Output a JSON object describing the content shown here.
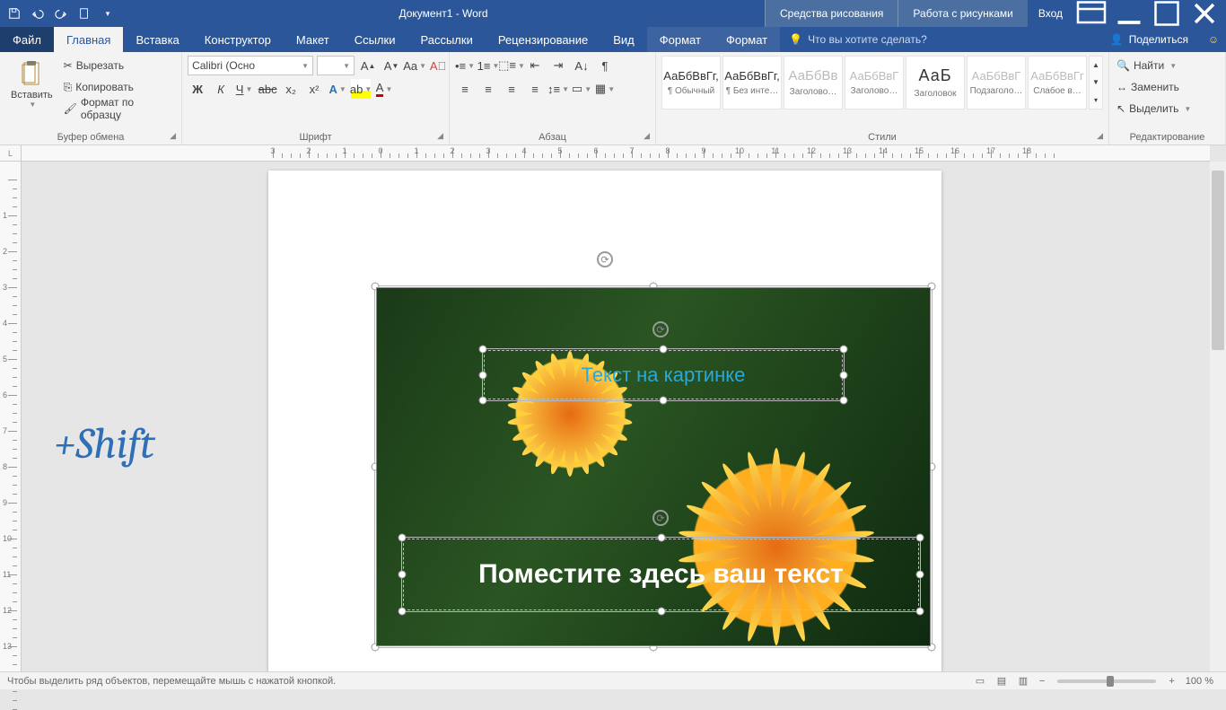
{
  "titlebar": {
    "doc_title": "Документ1 - Word",
    "ctx1": "Средства рисования",
    "ctx2": "Работа с рисунками",
    "login": "Вход"
  },
  "tabs": {
    "file": "Файл",
    "home": "Главная",
    "insert": "Вставка",
    "design": "Конструктор",
    "layout": "Макет",
    "refs": "Ссылки",
    "mail": "Рассылки",
    "review": "Рецензирование",
    "view": "Вид",
    "format1": "Формат",
    "format2": "Формат",
    "tellme_placeholder": "Что вы хотите сделать?",
    "share": "Поделиться"
  },
  "ribbon": {
    "clipboard": {
      "title": "Буфер обмена",
      "paste": "Вставить",
      "cut": "Вырезать",
      "copy": "Копировать",
      "fmtpainter": "Формат по образцу"
    },
    "font": {
      "title": "Шрифт",
      "name": "Calibri (Осно",
      "size": ""
    },
    "paragraph": {
      "title": "Абзац"
    },
    "styles": {
      "title": "Стили",
      "items": [
        {
          "sample": "АаБбВвГг,",
          "label": "¶ Обычный"
        },
        {
          "sample": "АаБбВвГг,",
          "label": "¶ Без инте…"
        },
        {
          "sample": "АаБбВв",
          "label": "Заголово…"
        },
        {
          "sample": "АаБбВвГ",
          "label": "Заголово…"
        },
        {
          "sample": "АаБ",
          "label": "Заголовок"
        },
        {
          "sample": "АаБбВвГ",
          "label": "Подзаголо…"
        },
        {
          "sample": "АаБбВвГг",
          "label": "Слабое в…"
        }
      ]
    },
    "editing": {
      "title": "Редактирование",
      "find": "Найти",
      "replace": "Заменить",
      "select": "Выделить"
    }
  },
  "ruler": {
    "corner": "L"
  },
  "overlay": {
    "shift": "+Shift"
  },
  "canvas": {
    "textbox_small": "Текст на картинке",
    "textbox_big": "Поместите здесь ваш текст"
  },
  "status": {
    "msg": "Чтобы выделить ряд объектов, перемещайте мышь с нажатой кнопкой.",
    "zoom": "100 %"
  }
}
